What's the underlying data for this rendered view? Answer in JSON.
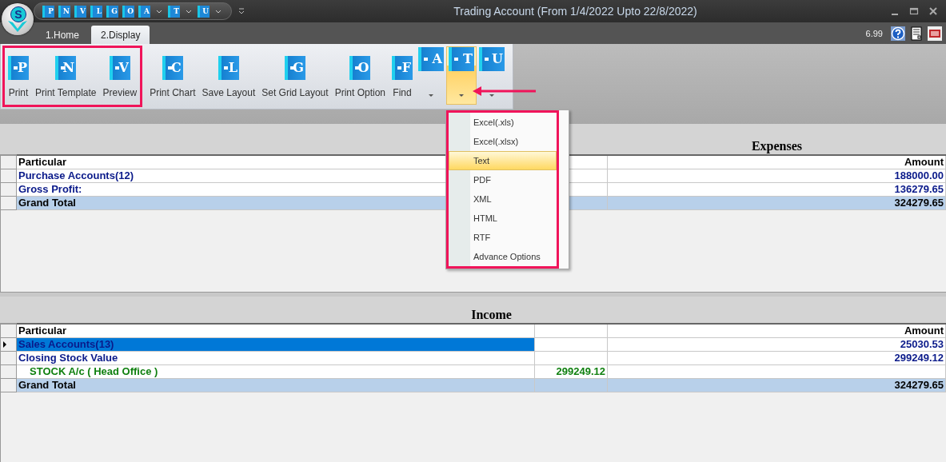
{
  "window": {
    "title": "Trading Account (From 1/4/2022 Upto 22/8/2022)"
  },
  "logo": {
    "letter": "S"
  },
  "quick_access": [
    {
      "letter": "P",
      "dropdown": false
    },
    {
      "letter": "N",
      "dropdown": false
    },
    {
      "letter": "V",
      "dropdown": false
    },
    {
      "letter": "L",
      "dropdown": false
    },
    {
      "letter": "G",
      "dropdown": false
    },
    {
      "letter": "O",
      "dropdown": false
    },
    {
      "letter": "A",
      "dropdown": true
    },
    {
      "letter": "T",
      "dropdown": true
    },
    {
      "letter": "U",
      "dropdown": true
    }
  ],
  "tabs": [
    {
      "label": "1.Home",
      "selected": false
    },
    {
      "label": "2.Display",
      "selected": true
    }
  ],
  "version": "6.99",
  "ribbon": {
    "groups": [
      {
        "annotated": true,
        "buttons": [
          {
            "kind": "large",
            "letter": "P",
            "label": "Print"
          },
          {
            "kind": "large",
            "letter": "N",
            "label": "Print Template"
          },
          {
            "kind": "large",
            "letter": "V",
            "label": "Preview"
          }
        ]
      },
      {
        "annotated": false,
        "buttons": [
          {
            "kind": "large",
            "letter": "C",
            "label": "Print Chart"
          },
          {
            "kind": "large",
            "letter": "L",
            "label": "Save Layout"
          },
          {
            "kind": "large",
            "letter": "G",
            "label": "Set Grid Layout"
          },
          {
            "kind": "large",
            "letter": "O",
            "label": "Print Option"
          },
          {
            "kind": "large",
            "letter": "F",
            "label": "Find"
          },
          {
            "kind": "split",
            "letter": "A",
            "open": false
          },
          {
            "kind": "split",
            "letter": "T",
            "open": true
          },
          {
            "kind": "split",
            "letter": "U",
            "open": false
          }
        ]
      }
    ],
    "annotation_arrow": true
  },
  "export_menu": {
    "annotated": true,
    "items": [
      {
        "label": "Excel(.xls)",
        "selected": false
      },
      {
        "label": "Excel(.xlsx)",
        "selected": false
      },
      {
        "label": "Text",
        "selected": true
      },
      {
        "label": "PDF",
        "selected": false
      },
      {
        "label": "XML",
        "selected": false
      },
      {
        "label": "HTML",
        "selected": false
      },
      {
        "label": "RTF",
        "selected": false
      },
      {
        "label": "Advance Options",
        "selected": false
      }
    ]
  },
  "expenses": {
    "title": "Expenses",
    "headers": {
      "particular": "Particular",
      "amount": "Amount"
    },
    "rows": [
      {
        "kind": "group",
        "particular": "Purchase Accounts(12)",
        "amount": "188000.00",
        "selected": false
      },
      {
        "kind": "group",
        "particular": "Gross Profit:",
        "amount": "136279.65",
        "selected": false
      },
      {
        "kind": "total",
        "particular": "Grand Total",
        "amount": "324279.65",
        "selected": false
      }
    ]
  },
  "income": {
    "title": "Income",
    "middle_column": true,
    "headers": {
      "particular": "Particular",
      "amount": "Amount"
    },
    "rows": [
      {
        "kind": "group",
        "particular": "Sales Accounts(13)",
        "amount": "25030.53",
        "selected": true
      },
      {
        "kind": "group",
        "particular": "Closing Stock Value",
        "amount": "299249.12",
        "selected": false
      },
      {
        "kind": "item",
        "particular": "STOCK A/c ( Head Office )",
        "middle": "299249.12",
        "selected": false
      },
      {
        "kind": "total",
        "particular": "Grand Total",
        "amount": "324279.65",
        "selected": false
      }
    ]
  }
}
